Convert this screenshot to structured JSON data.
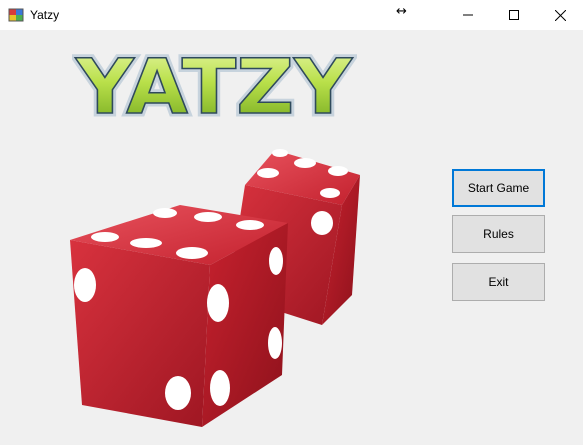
{
  "window": {
    "title": "Yatzy"
  },
  "logo": {
    "text": "YATZY"
  },
  "buttons": {
    "start": "Start Game",
    "rules": "Rules",
    "exit": "Exit"
  },
  "icons": {
    "app": "app-icon",
    "resize_cursor": "resize-horizontal-cursor-icon",
    "minimize": "minimize-icon",
    "maximize": "maximize-icon",
    "close": "close-icon"
  },
  "colors": {
    "accent": "#0078d7",
    "logo_green": "#9ccf2e",
    "dice_red": "#c8202e"
  }
}
